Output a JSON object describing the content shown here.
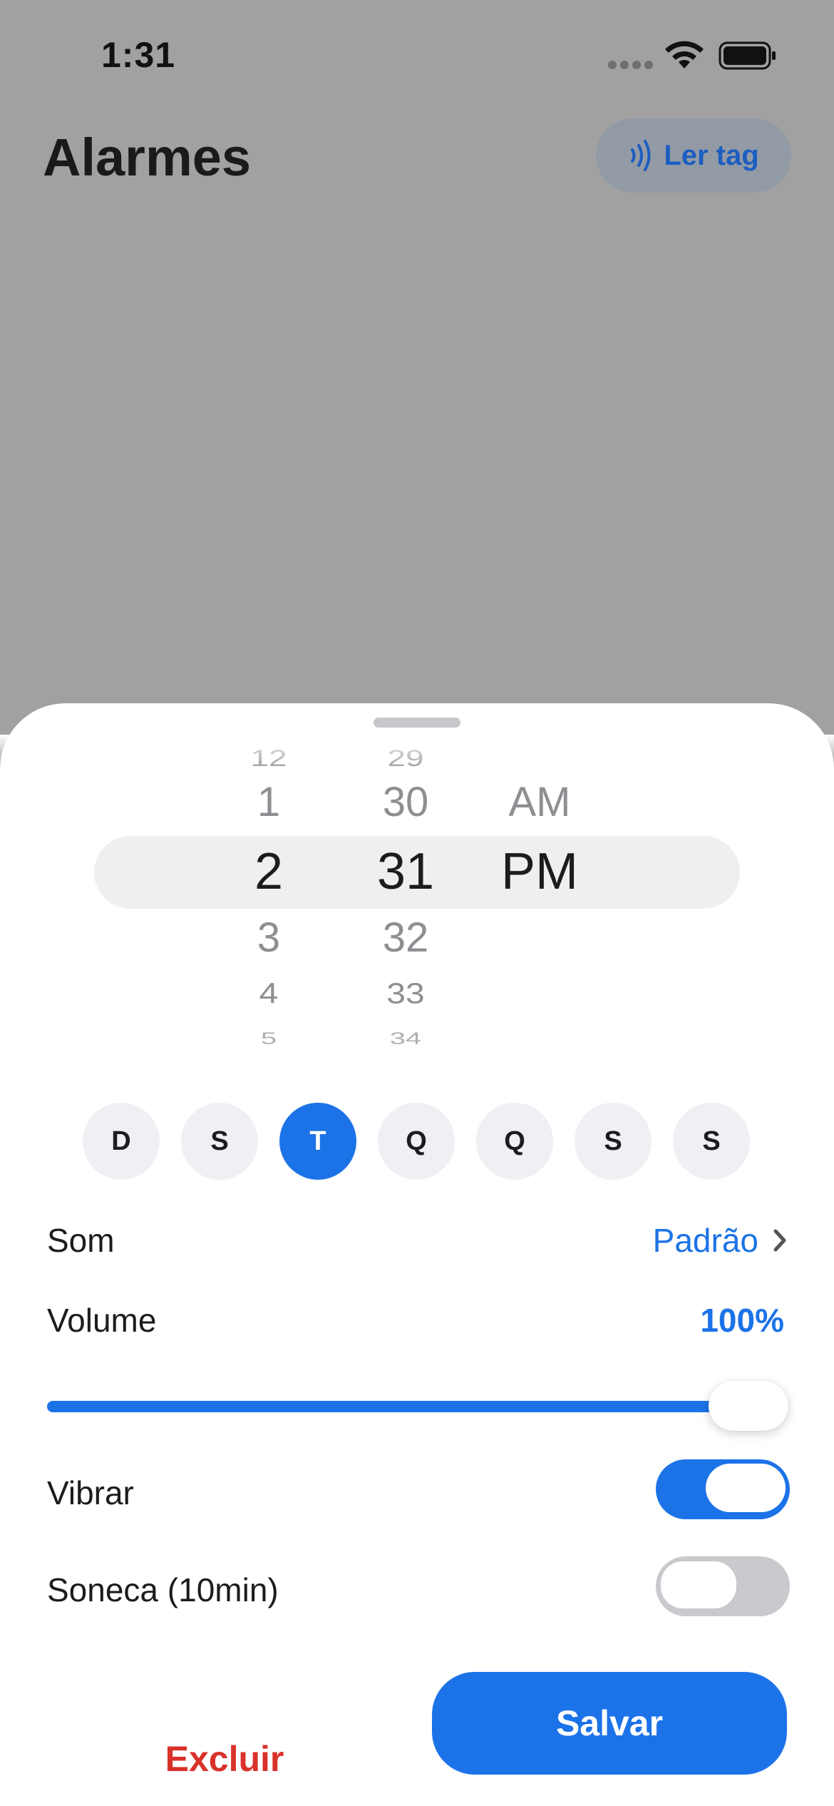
{
  "status_bar": {
    "time": "1:31"
  },
  "header": {
    "title": "Alarmes",
    "read_tag_label": "Ler tag"
  },
  "picker": {
    "hours": [
      "12",
      "1",
      "2",
      "3",
      "4",
      "5"
    ],
    "minutes": [
      "29",
      "30",
      "31",
      "32",
      "33",
      "34"
    ],
    "periods": [
      "AM",
      "PM"
    ],
    "selected": {
      "hour": "2",
      "minute": "31",
      "period": "PM"
    }
  },
  "days": [
    {
      "label": "D",
      "active": false
    },
    {
      "label": "S",
      "active": false
    },
    {
      "label": "T",
      "active": true
    },
    {
      "label": "Q",
      "active": false
    },
    {
      "label": "Q",
      "active": false
    },
    {
      "label": "S",
      "active": false
    },
    {
      "label": "S",
      "active": false
    }
  ],
  "sound": {
    "label": "Som",
    "value": "Padrão"
  },
  "volume": {
    "label": "Volume",
    "value_text": "100%",
    "level": 1.0
  },
  "vibrate": {
    "label": "Vibrar",
    "on": true
  },
  "snooze": {
    "label": "Soneca (10min)",
    "on": false
  },
  "actions": {
    "delete_label": "Excluir",
    "save_label": "Salvar"
  },
  "colors": {
    "accent": "#1c73e8",
    "destructive": "#d9322b",
    "backdrop": "#a1a1a1"
  }
}
